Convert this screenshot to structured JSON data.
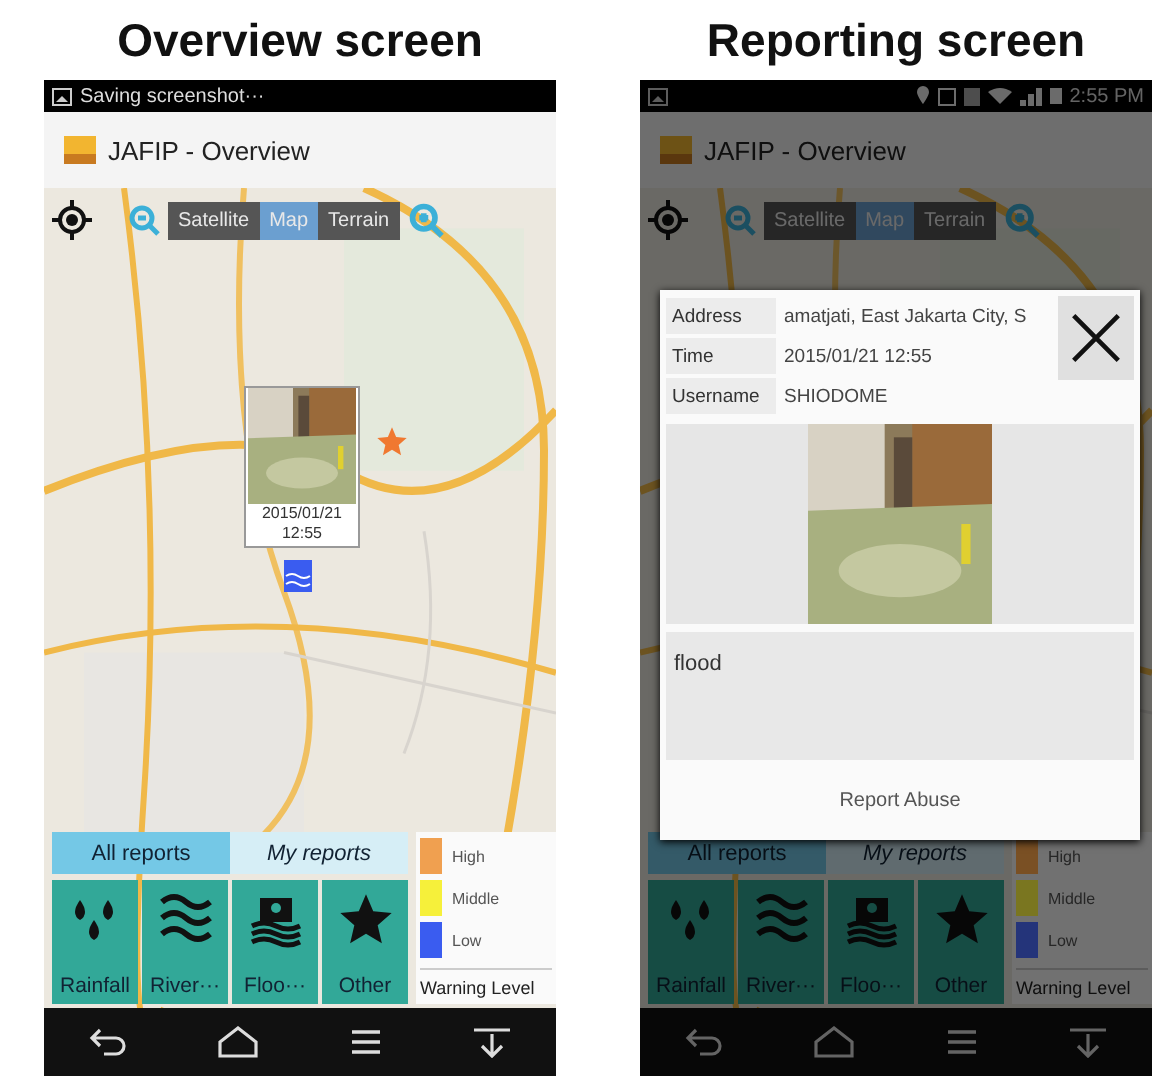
{
  "screens": [
    {
      "kind": "overview",
      "heading": "Overview screen",
      "status_bar": {
        "text": "Saving screenshot···"
      },
      "app_title": "JAFIP - Overview",
      "map_types": [
        {
          "label": "Satellite",
          "selected": false
        },
        {
          "label": "Map",
          "selected": true
        },
        {
          "label": "Terrain",
          "selected": false
        }
      ],
      "popup": {
        "date": "2015/01/21",
        "time": "12:55"
      },
      "report_tabs": [
        {
          "label": "All reports",
          "selected": true
        },
        {
          "label": "My reports",
          "selected": false
        }
      ],
      "categories": [
        {
          "kind": "rain",
          "label": "Rainfall"
        },
        {
          "kind": "river",
          "label": "River···"
        },
        {
          "kind": "flood",
          "label": "Floo···"
        },
        {
          "kind": "other",
          "label": "Other"
        }
      ],
      "legend": {
        "levels": [
          {
            "label": "High",
            "color": "#f0a050"
          },
          {
            "label": "Middle",
            "color": "#f6f03a"
          },
          {
            "label": "Low",
            "color": "#3a5cf0"
          }
        ],
        "title": "Warning Level"
      }
    },
    {
      "kind": "reporting",
      "heading": "Reporting screen",
      "status_bar": {
        "time": "2:55 PM"
      },
      "app_title": "JAFIP - Overview",
      "map_types": [
        {
          "label": "Satellite",
          "selected": false
        },
        {
          "label": "Map",
          "selected": true
        },
        {
          "label": "Terrain",
          "selected": false
        }
      ],
      "report_tabs": [
        {
          "label": "All reports",
          "selected": true
        },
        {
          "label": "My reports",
          "selected": false
        }
      ],
      "categories": [
        {
          "kind": "rain",
          "label": "Rainfall"
        },
        {
          "kind": "river",
          "label": "River···"
        },
        {
          "kind": "flood",
          "label": "Floo···"
        },
        {
          "kind": "other",
          "label": "Other"
        }
      ],
      "legend": {
        "levels": [
          {
            "label": "High",
            "color": "#7a5024"
          },
          {
            "label": "Middle",
            "color": "#7a7620"
          },
          {
            "label": "Low",
            "color": "#24347a"
          }
        ],
        "title": "Warning Level"
      },
      "dialog": {
        "fields": [
          {
            "label": "Address",
            "value": "amatjati, East Jakarta City, S"
          },
          {
            "label": "Time",
            "value": "2015/01/21 12:55"
          },
          {
            "label": "Username",
            "value": "SHIODOME"
          }
        ],
        "description": "flood",
        "action": "Report Abuse"
      }
    }
  ]
}
